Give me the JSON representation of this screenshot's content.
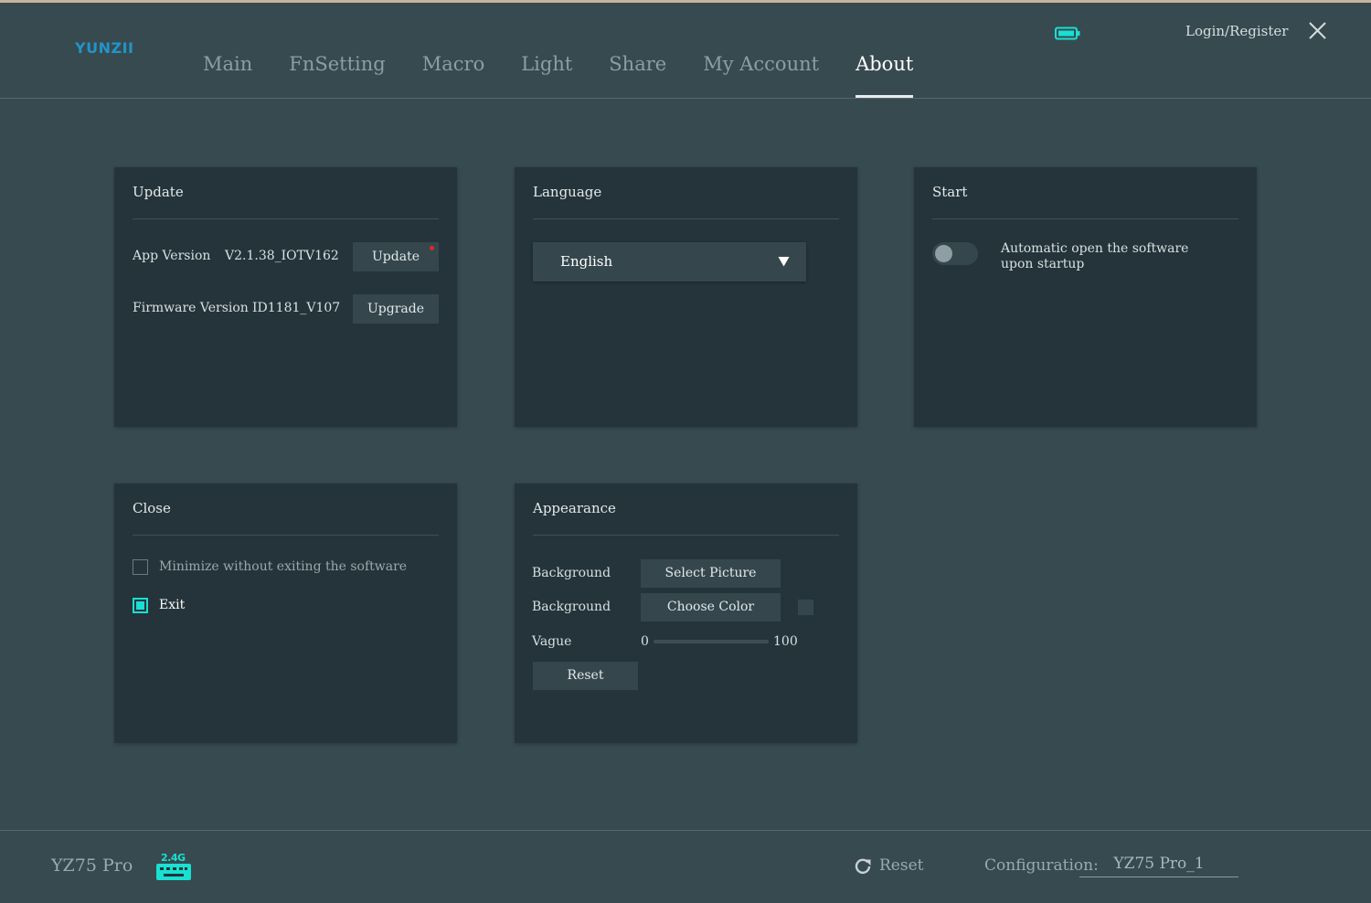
{
  "app": {
    "logo": "YUNZII"
  },
  "nav": {
    "tabs": [
      "Main",
      "FnSetting",
      "Macro",
      "Light",
      "Share",
      "My Account",
      "About"
    ],
    "active": "About"
  },
  "header": {
    "login_label": "Login/Register"
  },
  "colors": {
    "accent": "#18e0d2",
    "brand": "#2394c8",
    "update_dot": "#e0262b",
    "background": "#374a50",
    "panel": "#24343a"
  },
  "update": {
    "title": "Update",
    "app_version_label": "App Version",
    "app_version_value": "V2.1.38_IOTV162",
    "update_button": "Update",
    "firmware_version_label": "Firmware Version",
    "firmware_version_value": "ID1181_V107",
    "upgrade_button": "Upgrade"
  },
  "language": {
    "title": "Language",
    "selected": "English"
  },
  "start": {
    "title": "Start",
    "auto_open_text": "Automatic open the software upon startup",
    "auto_open_enabled": false
  },
  "close": {
    "title": "Close",
    "minimize_label": "Minimize without exiting the software",
    "minimize_checked": false,
    "exit_label": "Exit",
    "exit_checked": true
  },
  "appearance": {
    "title": "Appearance",
    "bg_picture_label": "Background",
    "select_picture_button": "Select Picture",
    "bg_color_label": "Background",
    "choose_color_button": "Choose Color",
    "vague_label": "Vague",
    "vague_min": "0",
    "vague_max": "100",
    "vague_value": 0,
    "reset_button": "Reset"
  },
  "footer": {
    "device_name": "YZ75 Pro",
    "dongle_label": "2.4G",
    "reset_label": "Reset",
    "config_label": "Configuration:",
    "config_value": "YZ75 Pro_1"
  },
  "icons": {
    "battery": "battery-icon",
    "close": "close-icon",
    "dongle": "keyboard-2.4g-icon",
    "reset": "refresh-icon",
    "dropdown": "triangle-down-icon"
  }
}
